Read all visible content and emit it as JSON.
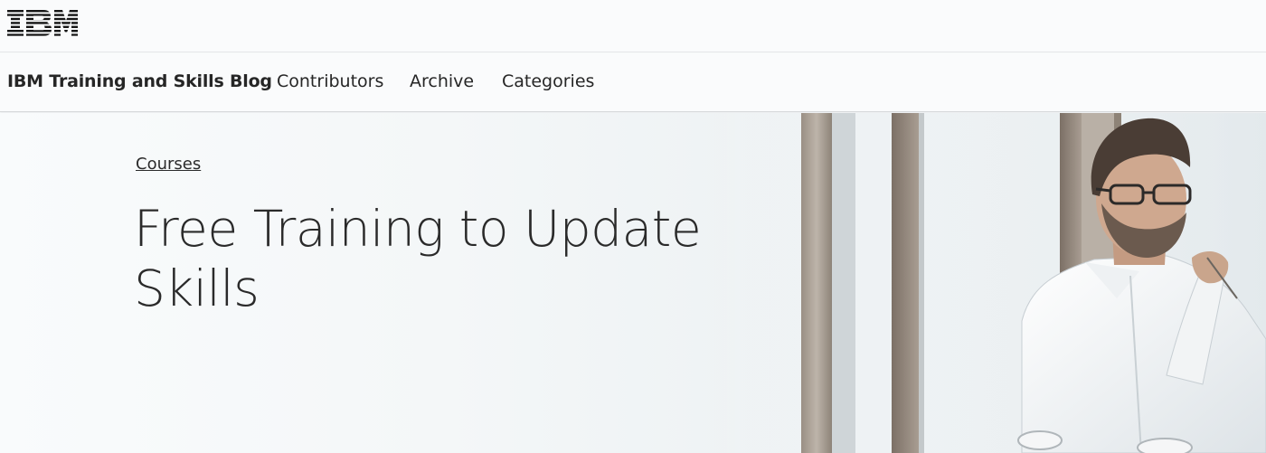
{
  "brand": {
    "logo_text": "IBM",
    "logo_color": "#161616"
  },
  "navbar": {
    "title": "IBM Training and Skills Blog",
    "links": [
      "Contributors",
      "Archive",
      "Categories"
    ]
  },
  "hero": {
    "category": "Courses",
    "title": "Free Training to Update Skills",
    "image": "photo of a man in glasses and white shirt seated by office window columns"
  },
  "colors": {
    "page_background": "#f8fafb",
    "text": "#262626",
    "divider": "#d6d8da"
  }
}
